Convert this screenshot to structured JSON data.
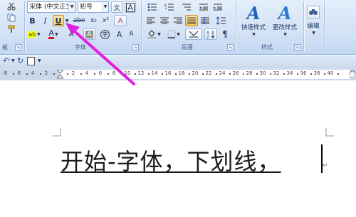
{
  "ribbon": {
    "font_group": {
      "font_name": "宋体 (中文正文)",
      "font_size": "初号",
      "label": "字体",
      "bold": "B",
      "italic": "I",
      "underline": "U",
      "strike": "abe",
      "subscript": "x₂",
      "superscript": "x²",
      "clear_format": "A",
      "highlight": "ab",
      "font_color": "A",
      "char_shade": "A",
      "char_border": "A",
      "enclose": "字",
      "grow": "A",
      "shrink": "A",
      "pinyin": "文",
      "border_char": "A"
    },
    "paragraph_group": {
      "label": "段落"
    },
    "styles_group": {
      "label": "样式",
      "quick_styles": "快速样式",
      "change_styles": "更改样式"
    },
    "editing_group": {
      "label": "编辑"
    },
    "left_labels": [
      "板"
    ]
  },
  "ruler": {
    "numbers": [
      "8",
      "6",
      "4",
      "2",
      "2",
      "4",
      "6",
      "8",
      "10",
      "12",
      "14",
      "16",
      "18",
      "20",
      "22",
      "24",
      "26",
      "28",
      "30",
      "32",
      "34",
      "36",
      "38",
      "40"
    ]
  },
  "document": {
    "text": "开始-字体，下划线，"
  },
  "colors": {
    "arrow": "#e020e0",
    "accent": "#1f64b8",
    "highlight": "#ffff00",
    "font_red": "#e01010"
  }
}
